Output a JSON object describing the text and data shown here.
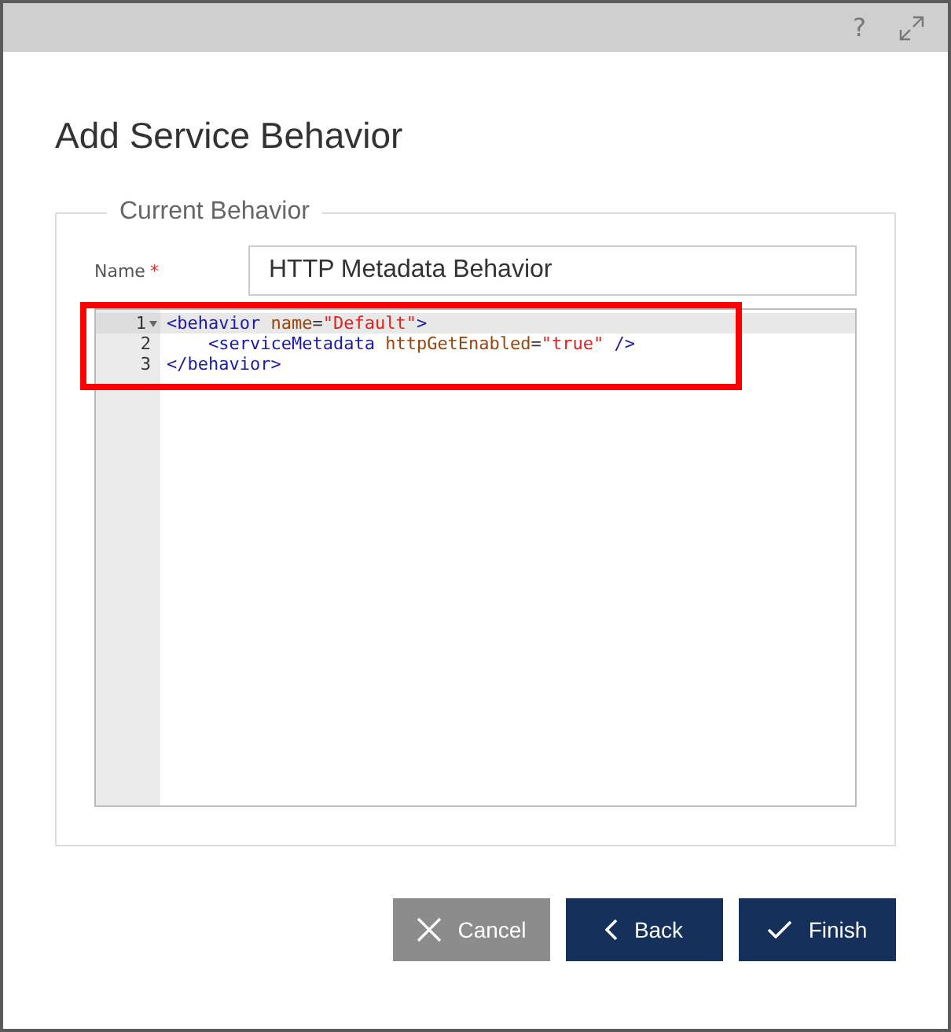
{
  "header": {
    "help": "?"
  },
  "title": "Add Service Behavior",
  "group": {
    "legend": "Current Behavior",
    "name_field": {
      "label": "Name",
      "required_mark": "*",
      "value": "HTTP Metadata Behavior"
    },
    "editor": {
      "highlight": true,
      "lines": [
        {
          "number": "1",
          "active": true,
          "foldable": true,
          "tokens": [
            {
              "kind": "tag",
              "text": "<behavior"
            },
            {
              "kind": "attr",
              "text": " name"
            },
            {
              "kind": "punct",
              "text": "="
            },
            {
              "kind": "value",
              "text": "\"Default\""
            },
            {
              "kind": "tag",
              "text": ">"
            }
          ]
        },
        {
          "number": "2",
          "active": false,
          "foldable": false,
          "tokens": [
            {
              "kind": "tag",
              "text": "    <serviceMetadata"
            },
            {
              "kind": "attr",
              "text": " httpGetEnabled"
            },
            {
              "kind": "punct",
              "text": "="
            },
            {
              "kind": "value",
              "text": "\"true\""
            },
            {
              "kind": "tag",
              "text": " />"
            }
          ]
        },
        {
          "number": "3",
          "active": false,
          "foldable": false,
          "tokens": [
            {
              "kind": "tag",
              "text": "</behavior>"
            }
          ]
        }
      ]
    }
  },
  "buttons": [
    {
      "label": "Cancel",
      "kind": "cancel"
    },
    {
      "label": "Back",
      "kind": "back"
    },
    {
      "label": "Finish",
      "kind": "finish"
    }
  ]
}
